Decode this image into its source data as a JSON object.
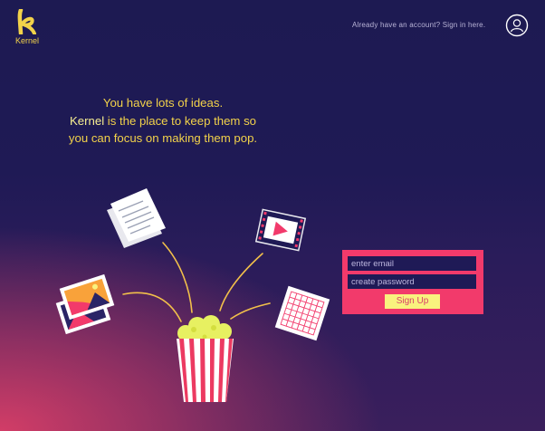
{
  "header": {
    "logo_text": "Kernel",
    "signin_text": "Already have an account? Sign in here."
  },
  "hero": {
    "line1": "You have lots of ideas.",
    "brand": "Kernel",
    "line2_rest": " is the place to keep them so",
    "line3": "you can focus on making them pop."
  },
  "signup_form": {
    "email_placeholder": "enter email",
    "password_placeholder": "create password",
    "submit_label": "Sign Up"
  },
  "colors": {
    "accent_yellow": "#f2d24a",
    "form_pink": "#f23a6b",
    "background_navy": "#1d1a52"
  }
}
